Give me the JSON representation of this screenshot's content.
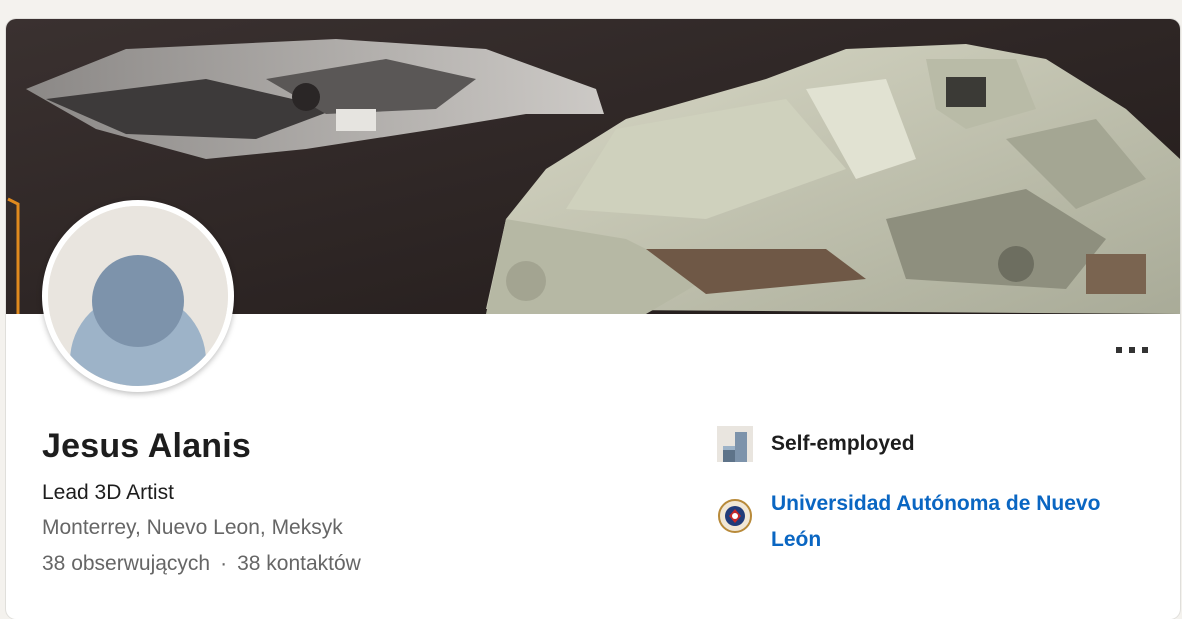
{
  "profile": {
    "name": "Jesus Alanis",
    "headline": "Lead 3D Artist",
    "location": "Monterrey, Nuevo Leon, Meksyk",
    "followers": "38 obserwujących",
    "separator": "·",
    "connections": "38 kontaktów"
  },
  "cover": {
    "icon": "cover-image-3d-render",
    "colors": {
      "background": "#2b2322",
      "model": "#c9cab5"
    }
  },
  "avatar": {
    "icon": "default-avatar-icon",
    "colors": {
      "bg": "#e9e5df",
      "figure": "#9db3c8",
      "head": "#7d93ab"
    }
  },
  "actions": {
    "more_icon": "more-horizontal-icon"
  },
  "experience": {
    "current_company": "Self-employed",
    "company_icon": "company-logo-icon"
  },
  "education": {
    "school": "Universidad Autónoma de Nuevo León",
    "school_icon": "university-seal-icon"
  },
  "theme": {
    "link": "#0a66c2",
    "text": "#1d1d1d",
    "muted": "#666666"
  }
}
